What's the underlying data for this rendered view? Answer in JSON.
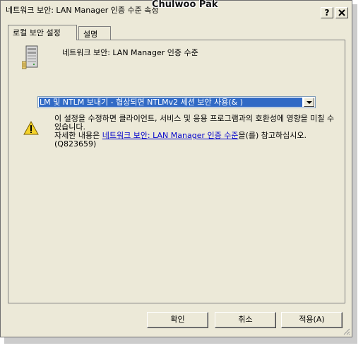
{
  "window": {
    "title": "네트워크 보안: LAN Manager 인증 수준 속성",
    "watermark": "Chulwoo Pak",
    "help_label": "?",
    "close_label": "X"
  },
  "tabs": [
    {
      "label": "로컬 보안 설정",
      "active": true
    },
    {
      "label": "설명",
      "active": false
    }
  ],
  "policy": {
    "name": "네트워크 보안: LAN Manager 인증 수준",
    "icon": "server-computer-icon",
    "selected_option": "LM 및 NTLM 보내기 - 협상되면 NTLMv2 세션 보안 사용(& )"
  },
  "warning": {
    "icon": "warning-triangle-icon",
    "line1": "이 설정을 수정하면 클라이언트, 서비스 및 응용 프로그램과의 호환성에 영향을 미칠 수 있습니다.",
    "line2_prefix": "자세한 내용은 ",
    "link_text": "네트워크 보안: LAN Manager 인증 수준",
    "line2_suffix": "을(를) 참고하십시오. (Q823659)"
  },
  "buttons": {
    "ok": "확인",
    "cancel": "취소",
    "apply": "적용(A)"
  },
  "colors": {
    "dialog_bg": "#ece9d8",
    "selection_bg": "#316ac5",
    "link": "#0000cc"
  }
}
